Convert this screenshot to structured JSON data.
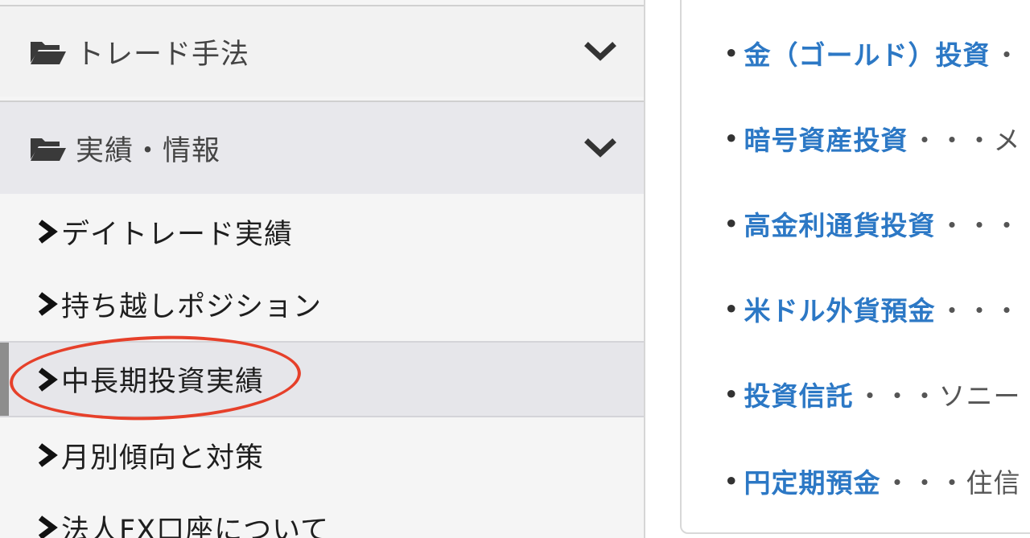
{
  "sidebar": {
    "sections": [
      {
        "label": "トレード手法",
        "icon": "folder-open-icon",
        "toggle_icon": "chevron-down-icon"
      },
      {
        "label": "実績・情報",
        "icon": "folder-open-icon",
        "toggle_icon": "chevron-down-icon"
      }
    ],
    "sub_items": [
      {
        "label": "デイトレード実績",
        "icon": "chevron-right-icon"
      },
      {
        "label": "持ち越しポジション",
        "icon": "chevron-right-icon"
      },
      {
        "label": "中長期投資実績",
        "icon": "chevron-right-icon",
        "active": true,
        "annotated": true
      },
      {
        "label": "月別傾向と対策",
        "icon": "chevron-right-icon"
      },
      {
        "label": "法人FX口座について",
        "icon": "chevron-right-icon"
      }
    ]
  },
  "content": {
    "links": [
      {
        "bullet": "•",
        "label": "金（ゴールド）投資",
        "desc": "・"
      },
      {
        "bullet": "•",
        "label": "暗号資産投資",
        "desc": "・・・メ"
      },
      {
        "bullet": "•",
        "label": "高金利通貨投資",
        "desc": "・・・"
      },
      {
        "bullet": "•",
        "label": "米ドル外貨預金",
        "desc": "・・・"
      },
      {
        "bullet": "•",
        "label": "投資信託",
        "desc": "・・・ソニー"
      },
      {
        "bullet": "•",
        "label": "円定期預金",
        "desc": "・・・住信"
      }
    ]
  },
  "colors": {
    "link": "#2c78c5",
    "annotation": "#e6402a",
    "active_bar": "#8d8d8d"
  }
}
